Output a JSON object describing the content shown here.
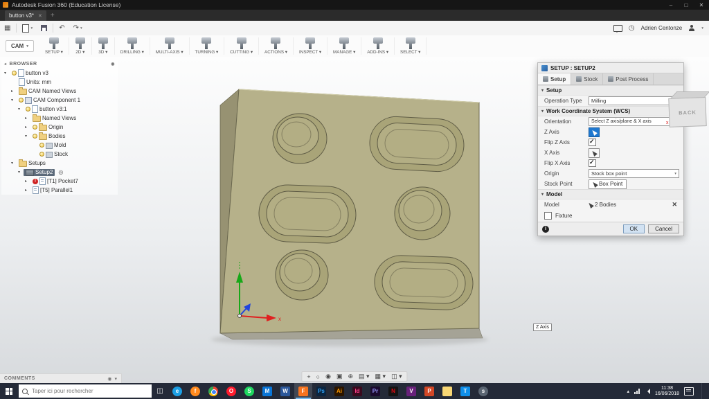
{
  "window": {
    "title": "Autodesk Fusion 360 (Education License)",
    "tab_title": "button v3*"
  },
  "ribbon": {
    "workspace_label": "CAM",
    "groups": [
      {
        "label": "SETUP"
      },
      {
        "label": "2D"
      },
      {
        "label": "3D"
      },
      {
        "label": "DRILLING"
      },
      {
        "label": "MULTI-AXIS"
      },
      {
        "label": "TURNING"
      },
      {
        "label": "CUTTING"
      },
      {
        "label": "ACTIONS"
      },
      {
        "label": "INSPECT"
      },
      {
        "label": "MANAGE"
      },
      {
        "label": "ADD-INS"
      },
      {
        "label": "SELECT"
      }
    ]
  },
  "account": {
    "user_name": "Adrien Centonze"
  },
  "browser": {
    "header": "BROWSER",
    "items": [
      {
        "label": "button v3",
        "depth": 0,
        "expand": "open",
        "icons": [
          "bulb",
          "doc"
        ]
      },
      {
        "label": "Units: mm",
        "depth": 1,
        "expand": "none",
        "icons": [
          "doc"
        ]
      },
      {
        "label": "CAM Named Views",
        "depth": 1,
        "expand": "closed",
        "icons": [
          "folder"
        ]
      },
      {
        "label": "CAM Component 1",
        "depth": 1,
        "expand": "open",
        "icons": [
          "bulb",
          "comp"
        ]
      },
      {
        "label": "button v3:1",
        "depth": 2,
        "expand": "open",
        "icons": [
          "bulb",
          "doc"
        ]
      },
      {
        "label": "Named Views",
        "depth": 3,
        "expand": "closed",
        "icons": [
          "folder"
        ]
      },
      {
        "label": "Origin",
        "depth": 3,
        "expand": "closed",
        "icons": [
          "bulb",
          "folder"
        ]
      },
      {
        "label": "Bodies",
        "depth": 3,
        "expand": "open",
        "icons": [
          "bulb",
          "folder"
        ]
      },
      {
        "label": "Mold",
        "depth": 4,
        "expand": "none",
        "icons": [
          "bulb",
          "body"
        ]
      },
      {
        "label": "Stock",
        "depth": 4,
        "expand": "none",
        "icons": [
          "bulb",
          "body"
        ]
      },
      {
        "label": "Setups",
        "depth": 1,
        "expand": "open",
        "icons": [
          "folder"
        ]
      },
      {
        "label": "Setup2",
        "depth": 2,
        "expand": "open",
        "icons": [
          "setup"
        ],
        "selected": true,
        "trailing": "suppress"
      },
      {
        "label": "[T1] Pocket7",
        "depth": 3,
        "expand": "closed",
        "icons": [
          "warn",
          "op"
        ]
      },
      {
        "label": "[T5] Parallel1",
        "depth": 3,
        "expand": "closed",
        "icons": [
          "op"
        ]
      }
    ]
  },
  "dialog": {
    "title": "SETUP : SETUP2",
    "tabs": [
      {
        "label": "Setup",
        "active": true
      },
      {
        "label": "Stock"
      },
      {
        "label": "Post Process"
      }
    ],
    "sections": {
      "setup": "Setup",
      "wcs": "Work Coordinate System (WCS)",
      "model": "Model"
    },
    "fields": {
      "operation_type_label": "Operation Type",
      "operation_type_value": "Milling",
      "orientation_label": "Orientation",
      "orientation_value": "Select Z axis/plane & X axis",
      "z_axis_label": "Z Axis",
      "flip_z_label": "Flip Z Axis",
      "x_axis_label": "X Axis",
      "flip_x_label": "Flip X Axis",
      "origin_label": "Origin",
      "origin_value": "Stock box point",
      "stock_point_label": "Stock Point",
      "stock_point_value": "Box Point",
      "model_label": "Model",
      "model_value": "2 Bodies",
      "fixture_label": "Fixture"
    },
    "checks": {
      "flip_z": true,
      "flip_x": true,
      "fixture": false
    },
    "buttons": {
      "ok": "OK",
      "cancel": "Cancel"
    }
  },
  "canvas": {
    "tooltip": "Z Axis",
    "viewcube_face": "BACK",
    "axis_x_label": "x"
  },
  "navbar": {
    "items": [
      {
        "name": "pan",
        "glyph": "+"
      },
      {
        "name": "orbit",
        "glyph": "○"
      },
      {
        "name": "look-at",
        "glyph": "◉"
      },
      {
        "name": "zoom-window",
        "glyph": "▣"
      },
      {
        "name": "zoom",
        "glyph": "⊕"
      },
      {
        "name": "display-settings",
        "glyph": "▤",
        "dropdown": true
      },
      {
        "name": "grid-and-snaps",
        "glyph": "▦",
        "dropdown": true
      },
      {
        "name": "viewports",
        "glyph": "◫",
        "dropdown": true
      }
    ]
  },
  "comments": {
    "label": "COMMENTS"
  },
  "taskbar": {
    "search_placeholder": "Taper ici pour rechercher",
    "time": "11:38",
    "date": "16/06/2018",
    "apps": [
      {
        "name": "edge",
        "glyph": "e",
        "bg": "#1b9ee3",
        "shape": "circle"
      },
      {
        "name": "firefox",
        "glyph": "f",
        "bg": "#ff8a1e",
        "shape": "circle"
      },
      {
        "name": "chrome",
        "glyph": "",
        "bg": "",
        "shape": "circle"
      },
      {
        "name": "opera",
        "glyph": "O",
        "bg": "#ff1b2d",
        "shape": "circle"
      },
      {
        "name": "spotify",
        "glyph": "S",
        "bg": "#1ed760",
        "shape": "circle"
      },
      {
        "name": "mail",
        "glyph": "M",
        "bg": "#0a76d8",
        "shape": "square"
      },
      {
        "name": "word",
        "glyph": "W",
        "bg": "#2b579a",
        "shape": "square"
      },
      {
        "name": "fusion-360",
        "glyph": "F",
        "bg": "#f6731e",
        "shape": "square",
        "active": true
      },
      {
        "name": "photoshop",
        "glyph": "Ps",
        "bg": "#0b2540",
        "fg": "#31a8ff",
        "shape": "square"
      },
      {
        "name": "illustrator",
        "glyph": "Ai",
        "bg": "#2b1500",
        "fg": "#ff9a00",
        "shape": "square"
      },
      {
        "name": "indesign",
        "glyph": "Id",
        "bg": "#3a0a1e",
        "fg": "#ff408c",
        "shape": "square"
      },
      {
        "name": "premiere",
        "glyph": "Pr",
        "bg": "#1a0a2e",
        "fg": "#9999ff",
        "shape": "square"
      },
      {
        "name": "netflix",
        "glyph": "N",
        "bg": "#141414",
        "fg": "#e50914",
        "shape": "square"
      },
      {
        "name": "visual-studio",
        "glyph": "V",
        "bg": "#68217a",
        "shape": "square"
      },
      {
        "name": "powerpoint",
        "glyph": "P",
        "bg": "#d24726",
        "shape": "square"
      },
      {
        "name": "file-explorer",
        "glyph": "",
        "bg": "#f8d775",
        "shape": "square"
      },
      {
        "name": "teamviewer",
        "glyph": "T",
        "bg": "#0e8ee9",
        "shape": "square"
      },
      {
        "name": "steam",
        "glyph": "s",
        "bg": "#5a6572",
        "shape": "circle"
      }
    ]
  }
}
